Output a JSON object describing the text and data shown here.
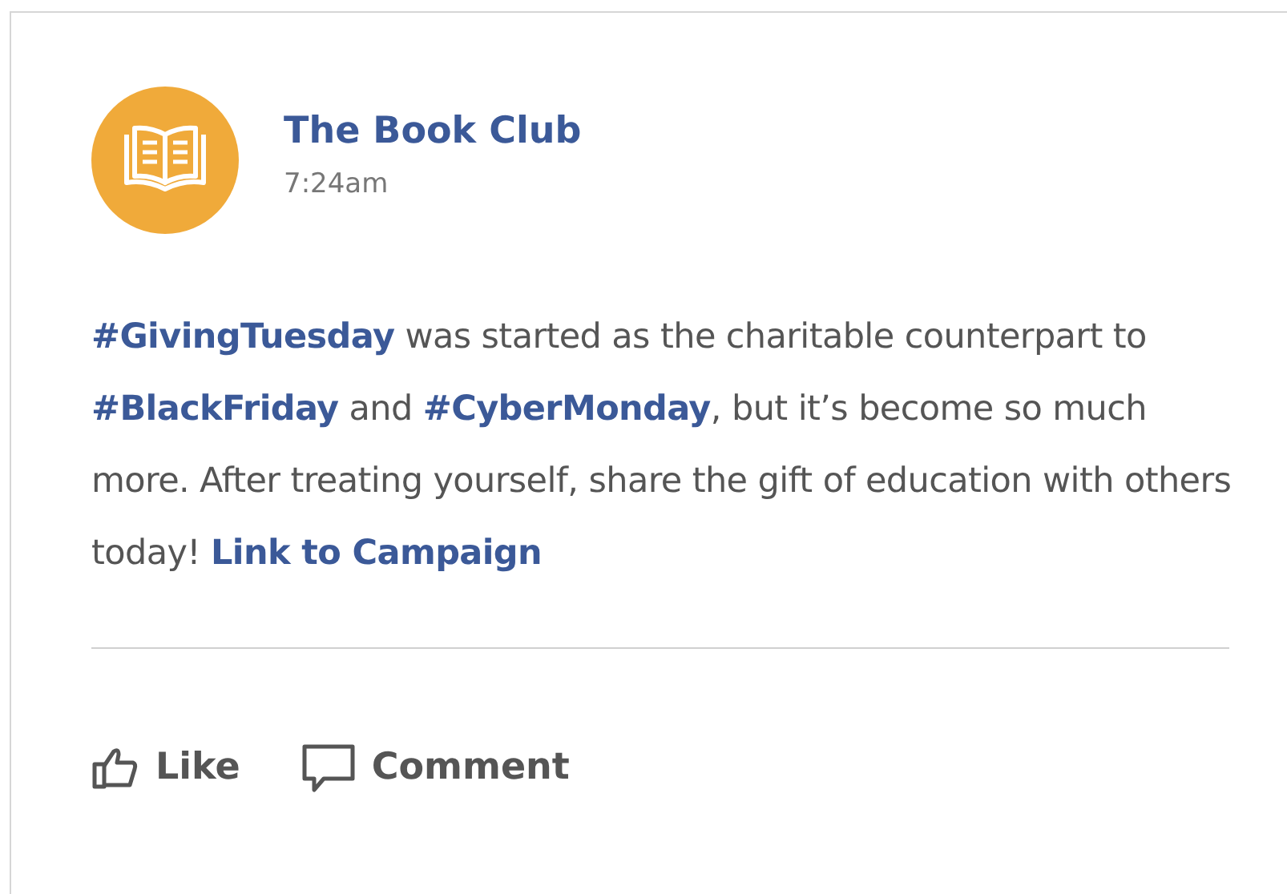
{
  "post": {
    "author": "The Book Club",
    "time": "7:24am",
    "body": [
      {
        "kind": "hashtag",
        "text": "#GivingTuesday"
      },
      {
        "kind": "text",
        "text": " was started as the charitable counterpart to "
      },
      {
        "kind": "hashtag",
        "text": "#BlackFriday"
      },
      {
        "kind": "text",
        "text": " and "
      },
      {
        "kind": "hashtag",
        "text": "#CyberMonday"
      },
      {
        "kind": "text",
        "text": ", but it’s become so much more. After treating yourself, share the gift of education with others today!  "
      },
      {
        "kind": "link",
        "text": "Link to Campaign"
      }
    ],
    "actions": [
      {
        "kind": "like",
        "label": "Like"
      },
      {
        "kind": "comment",
        "label": "Comment"
      }
    ]
  }
}
